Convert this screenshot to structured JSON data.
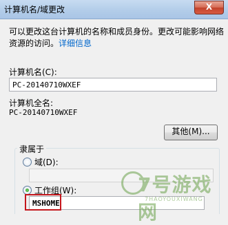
{
  "window": {
    "title": "计算机名/域更改",
    "close_label": "X"
  },
  "description": {
    "text": "可以更改这台计算机的名称和成员身份。更改可能影响网络资源的访问。",
    "link": "详细信息"
  },
  "computer_name": {
    "label": "计算机名(C):",
    "value": "PC-20140710WXEF"
  },
  "full_name": {
    "label": "计算机全名:",
    "value": "PC-20140710WXEF"
  },
  "more_button": "其他(M)...",
  "member_of": {
    "title": "隶属于",
    "domain_label": "域(D):",
    "domain_value": "",
    "workgroup_label": "工作组(W):",
    "workgroup_value": "MSHOME"
  },
  "watermark": {
    "text": "7号游戏网",
    "sub": "7HAOYOUXIWANG"
  }
}
